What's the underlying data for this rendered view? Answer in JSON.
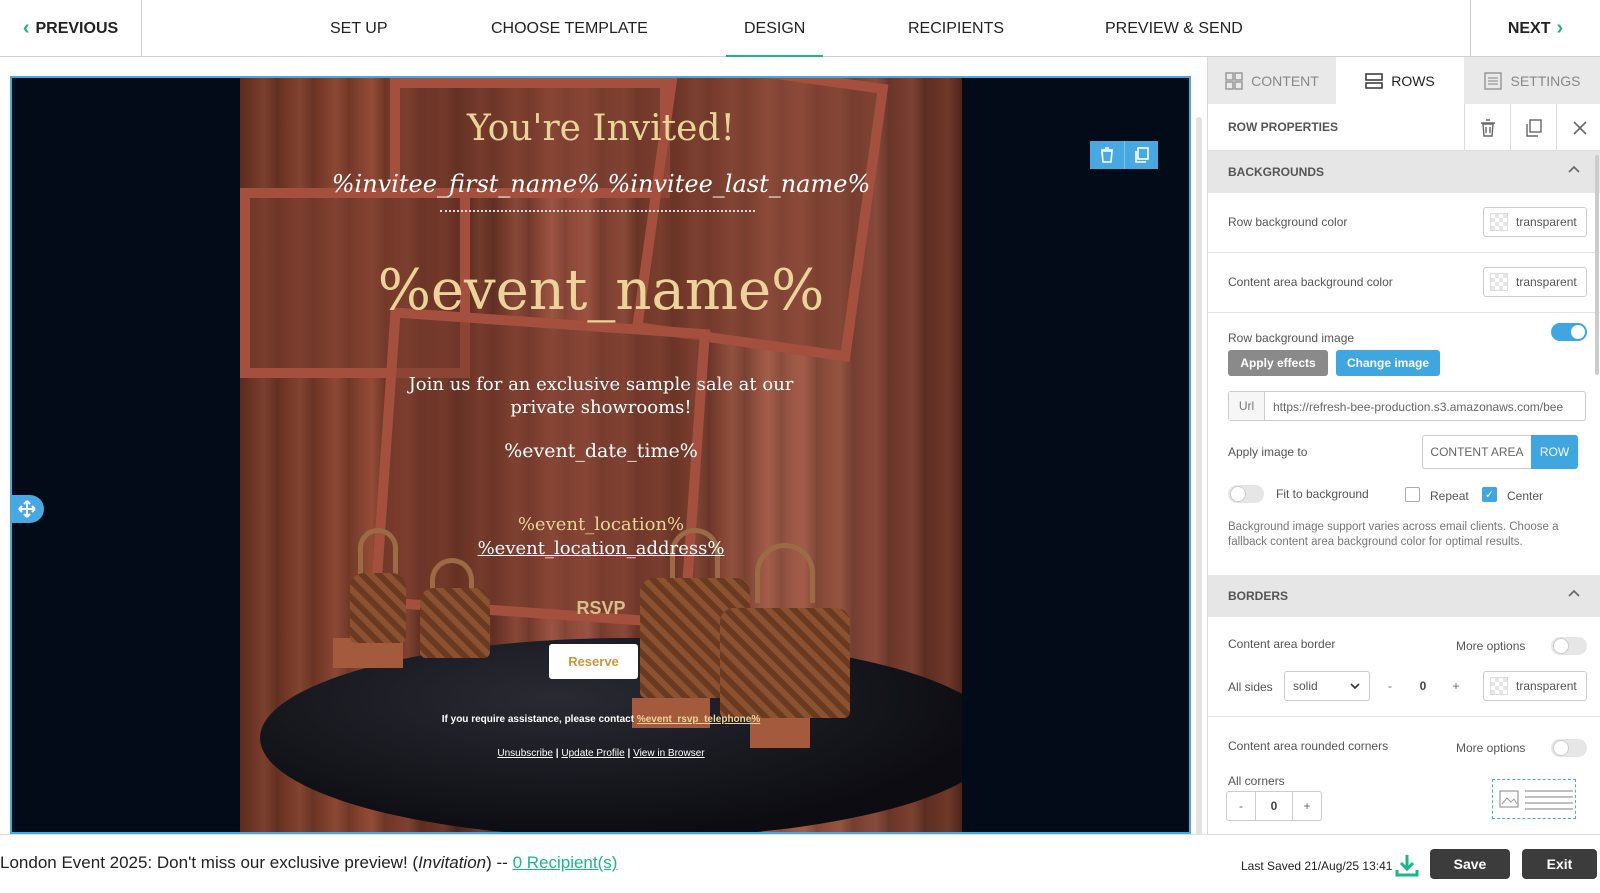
{
  "nav": {
    "previous": "PREVIOUS",
    "next": "NEXT",
    "steps": [
      "SET UP",
      "CHOOSE TEMPLATE",
      "DESIGN",
      "RECIPIENTS",
      "PREVIEW & SEND"
    ],
    "active_step": "DESIGN"
  },
  "email": {
    "title": "You're Invited!",
    "invitee": "%invitee_first_name% %invitee_last_name%",
    "event_name": "%event_name%",
    "intro": "Join us for an exclusive sample sale at our private showrooms!",
    "date_time": "%event_date_time%",
    "location": "%event_location%",
    "location_address": "%event_location_address%",
    "rsvp": "RSVP",
    "reserve": "Reserve",
    "assist_text": "If you require assistance, please contact",
    "assist_phone": "%event_rsvp_telephone%",
    "links": [
      "Unsubscribe",
      "Update Profile",
      "View in Browser"
    ],
    "separator": "|"
  },
  "panel": {
    "tabs": [
      "CONTENT",
      "ROWS",
      "SETTINGS"
    ],
    "active_tab": "ROWS",
    "row_properties": "ROW PROPERTIES",
    "backgrounds": {
      "header": "BACKGROUNDS",
      "row_bg_color_label": "Row background color",
      "row_bg_color_value": "transparent",
      "content_bg_color_label": "Content area background color",
      "content_bg_color_value": "transparent",
      "row_bg_image_label": "Row background image",
      "row_bg_image_enabled": true,
      "apply_effects": "Apply effects",
      "change_image": "Change image",
      "url_prefix": "Url",
      "url_value": "https://refresh-bee-production.s3.amazonaws.com/bee",
      "apply_to_label": "Apply image to",
      "apply_to_options": [
        "CONTENT AREA",
        "ROW"
      ],
      "apply_to_selected": "ROW",
      "fit_label": "Fit to background",
      "fit_enabled": false,
      "repeat_label": "Repeat",
      "repeat_checked": false,
      "center_label": "Center",
      "center_checked": true,
      "note": "Background image support varies across email clients. Choose a fallback content area background color for optimal results."
    },
    "borders": {
      "header": "BORDERS",
      "content_border_label": "Content area border",
      "more_options": "More options",
      "all_sides_label": "All sides",
      "style": "solid",
      "width": "0",
      "color": "transparent",
      "rounded_label": "Content area rounded corners",
      "all_corners_label": "All corners",
      "corners_value": "0",
      "minus": "-",
      "plus": "+"
    }
  },
  "footer": {
    "campaign_text": "London Event 2025: Don't miss our exclusive preview! (",
    "campaign_type": "Invitation",
    "campaign_sep": ") -- ",
    "recipients": "0 Recipient(s)",
    "last_saved": "Last Saved 21/Aug/25 13:41",
    "save": "Save",
    "exit": "Exit"
  },
  "colors": {
    "accent_green": "#1bb58a",
    "accent_blue": "#3fa6e0",
    "gold_text": "#ecd39a",
    "dark_button": "#3c3c3c"
  }
}
